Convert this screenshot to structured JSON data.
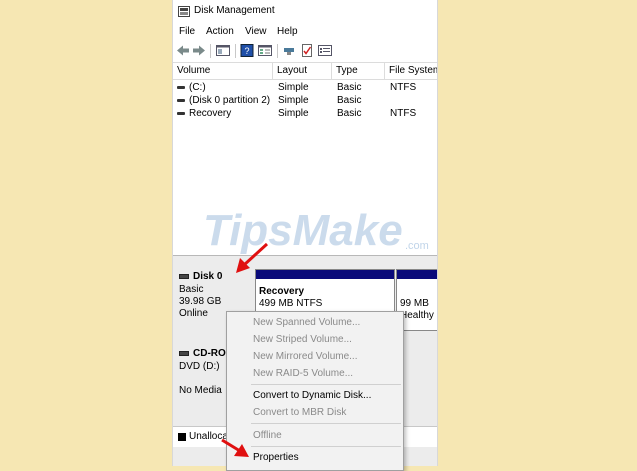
{
  "window": {
    "title": "Disk Management"
  },
  "menu": [
    "File",
    "Action",
    "View",
    "Help"
  ],
  "toolbar": {
    "icons": [
      "back-arrow-icon",
      "forward-arrow-icon",
      "console-tree-icon",
      "help-icon",
      "list-view-icon",
      "connect-icon",
      "checklist-icon",
      "properties-icon"
    ]
  },
  "volume_list": {
    "columns": [
      "Volume",
      "Layout",
      "Type",
      "File System"
    ],
    "rows": [
      {
        "volume": "(C:)",
        "layout": "Simple",
        "type": "Basic",
        "fs": "NTFS"
      },
      {
        "volume": "(Disk 0 partition 2)",
        "layout": "Simple",
        "type": "Basic",
        "fs": ""
      },
      {
        "volume": "Recovery",
        "layout": "Simple",
        "type": "Basic",
        "fs": "NTFS"
      }
    ]
  },
  "watermark": {
    "text": "TipsMake",
    "suffix": ".com"
  },
  "disk0": {
    "name": "Disk 0",
    "type": "Basic",
    "size": "39.98 GB",
    "status": "Online",
    "partitions": [
      {
        "name": "Recovery",
        "detail": "499 MB NTFS"
      },
      {
        "name": "",
        "detail": "99 MB",
        "status": "Healthy ("
      }
    ]
  },
  "cdrom": {
    "name": "CD-ROM",
    "drive": "DVD (D:)",
    "media": "No Media"
  },
  "legend": {
    "unallocated": "Unallocated"
  },
  "context_menu": {
    "items": [
      {
        "label": "New Spanned Volume...",
        "enabled": false
      },
      {
        "label": "New Striped Volume...",
        "enabled": false
      },
      {
        "label": "New Mirrored Volume...",
        "enabled": false
      },
      {
        "label": "New RAID-5 Volume...",
        "enabled": false
      },
      {
        "label": "Convert to Dynamic Disk...",
        "enabled": true
      },
      {
        "label": "Convert to MBR Disk",
        "enabled": false
      },
      {
        "label": "Offline",
        "enabled": false
      },
      {
        "label": "Properties",
        "enabled": true
      }
    ]
  },
  "colors": {
    "background": "#f6e7b3",
    "partition_header": "#0a0a7a",
    "arrow": "#e01010",
    "watermark_blue": "#2f6fb5"
  }
}
